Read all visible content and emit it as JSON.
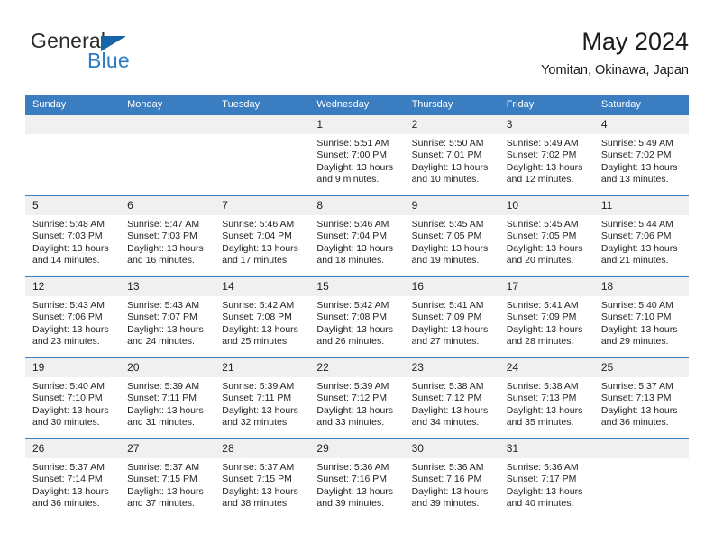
{
  "brand": {
    "name_top": "General",
    "name_bottom": "Blue",
    "triangle_color": "#1565a8",
    "blue_text_color": "#2e7dc4"
  },
  "header": {
    "title": "May 2024",
    "subtitle": "Yomitan, Okinawa, Japan"
  },
  "theme": {
    "header_blue": "#3a7dc0",
    "daynum_band": "#f0f0f0",
    "text": "#231f20"
  },
  "weekdays": [
    "Sunday",
    "Monday",
    "Tuesday",
    "Wednesday",
    "Thursday",
    "Friday",
    "Saturday"
  ],
  "weeks": [
    [
      {
        "day": "",
        "blank": true
      },
      {
        "day": "",
        "blank": true
      },
      {
        "day": "",
        "blank": true
      },
      {
        "day": "1",
        "sunrise": "Sunrise: 5:51 AM",
        "sunset": "Sunset: 7:00 PM",
        "daylight1": "Daylight: 13 hours",
        "daylight2": "and 9 minutes."
      },
      {
        "day": "2",
        "sunrise": "Sunrise: 5:50 AM",
        "sunset": "Sunset: 7:01 PM",
        "daylight1": "Daylight: 13 hours",
        "daylight2": "and 10 minutes."
      },
      {
        "day": "3",
        "sunrise": "Sunrise: 5:49 AM",
        "sunset": "Sunset: 7:02 PM",
        "daylight1": "Daylight: 13 hours",
        "daylight2": "and 12 minutes."
      },
      {
        "day": "4",
        "sunrise": "Sunrise: 5:49 AM",
        "sunset": "Sunset: 7:02 PM",
        "daylight1": "Daylight: 13 hours",
        "daylight2": "and 13 minutes."
      }
    ],
    [
      {
        "day": "5",
        "sunrise": "Sunrise: 5:48 AM",
        "sunset": "Sunset: 7:03 PM",
        "daylight1": "Daylight: 13 hours",
        "daylight2": "and 14 minutes."
      },
      {
        "day": "6",
        "sunrise": "Sunrise: 5:47 AM",
        "sunset": "Sunset: 7:03 PM",
        "daylight1": "Daylight: 13 hours",
        "daylight2": "and 16 minutes."
      },
      {
        "day": "7",
        "sunrise": "Sunrise: 5:46 AM",
        "sunset": "Sunset: 7:04 PM",
        "daylight1": "Daylight: 13 hours",
        "daylight2": "and 17 minutes."
      },
      {
        "day": "8",
        "sunrise": "Sunrise: 5:46 AM",
        "sunset": "Sunset: 7:04 PM",
        "daylight1": "Daylight: 13 hours",
        "daylight2": "and 18 minutes."
      },
      {
        "day": "9",
        "sunrise": "Sunrise: 5:45 AM",
        "sunset": "Sunset: 7:05 PM",
        "daylight1": "Daylight: 13 hours",
        "daylight2": "and 19 minutes."
      },
      {
        "day": "10",
        "sunrise": "Sunrise: 5:45 AM",
        "sunset": "Sunset: 7:05 PM",
        "daylight1": "Daylight: 13 hours",
        "daylight2": "and 20 minutes."
      },
      {
        "day": "11",
        "sunrise": "Sunrise: 5:44 AM",
        "sunset": "Sunset: 7:06 PM",
        "daylight1": "Daylight: 13 hours",
        "daylight2": "and 21 minutes."
      }
    ],
    [
      {
        "day": "12",
        "sunrise": "Sunrise: 5:43 AM",
        "sunset": "Sunset: 7:06 PM",
        "daylight1": "Daylight: 13 hours",
        "daylight2": "and 23 minutes."
      },
      {
        "day": "13",
        "sunrise": "Sunrise: 5:43 AM",
        "sunset": "Sunset: 7:07 PM",
        "daylight1": "Daylight: 13 hours",
        "daylight2": "and 24 minutes."
      },
      {
        "day": "14",
        "sunrise": "Sunrise: 5:42 AM",
        "sunset": "Sunset: 7:08 PM",
        "daylight1": "Daylight: 13 hours",
        "daylight2": "and 25 minutes."
      },
      {
        "day": "15",
        "sunrise": "Sunrise: 5:42 AM",
        "sunset": "Sunset: 7:08 PM",
        "daylight1": "Daylight: 13 hours",
        "daylight2": "and 26 minutes."
      },
      {
        "day": "16",
        "sunrise": "Sunrise: 5:41 AM",
        "sunset": "Sunset: 7:09 PM",
        "daylight1": "Daylight: 13 hours",
        "daylight2": "and 27 minutes."
      },
      {
        "day": "17",
        "sunrise": "Sunrise: 5:41 AM",
        "sunset": "Sunset: 7:09 PM",
        "daylight1": "Daylight: 13 hours",
        "daylight2": "and 28 minutes."
      },
      {
        "day": "18",
        "sunrise": "Sunrise: 5:40 AM",
        "sunset": "Sunset: 7:10 PM",
        "daylight1": "Daylight: 13 hours",
        "daylight2": "and 29 minutes."
      }
    ],
    [
      {
        "day": "19",
        "sunrise": "Sunrise: 5:40 AM",
        "sunset": "Sunset: 7:10 PM",
        "daylight1": "Daylight: 13 hours",
        "daylight2": "and 30 minutes."
      },
      {
        "day": "20",
        "sunrise": "Sunrise: 5:39 AM",
        "sunset": "Sunset: 7:11 PM",
        "daylight1": "Daylight: 13 hours",
        "daylight2": "and 31 minutes."
      },
      {
        "day": "21",
        "sunrise": "Sunrise: 5:39 AM",
        "sunset": "Sunset: 7:11 PM",
        "daylight1": "Daylight: 13 hours",
        "daylight2": "and 32 minutes."
      },
      {
        "day": "22",
        "sunrise": "Sunrise: 5:39 AM",
        "sunset": "Sunset: 7:12 PM",
        "daylight1": "Daylight: 13 hours",
        "daylight2": "and 33 minutes."
      },
      {
        "day": "23",
        "sunrise": "Sunrise: 5:38 AM",
        "sunset": "Sunset: 7:12 PM",
        "daylight1": "Daylight: 13 hours",
        "daylight2": "and 34 minutes."
      },
      {
        "day": "24",
        "sunrise": "Sunrise: 5:38 AM",
        "sunset": "Sunset: 7:13 PM",
        "daylight1": "Daylight: 13 hours",
        "daylight2": "and 35 minutes."
      },
      {
        "day": "25",
        "sunrise": "Sunrise: 5:37 AM",
        "sunset": "Sunset: 7:13 PM",
        "daylight1": "Daylight: 13 hours",
        "daylight2": "and 36 minutes."
      }
    ],
    [
      {
        "day": "26",
        "sunrise": "Sunrise: 5:37 AM",
        "sunset": "Sunset: 7:14 PM",
        "daylight1": "Daylight: 13 hours",
        "daylight2": "and 36 minutes."
      },
      {
        "day": "27",
        "sunrise": "Sunrise: 5:37 AM",
        "sunset": "Sunset: 7:15 PM",
        "daylight1": "Daylight: 13 hours",
        "daylight2": "and 37 minutes."
      },
      {
        "day": "28",
        "sunrise": "Sunrise: 5:37 AM",
        "sunset": "Sunset: 7:15 PM",
        "daylight1": "Daylight: 13 hours",
        "daylight2": "and 38 minutes."
      },
      {
        "day": "29",
        "sunrise": "Sunrise: 5:36 AM",
        "sunset": "Sunset: 7:16 PM",
        "daylight1": "Daylight: 13 hours",
        "daylight2": "and 39 minutes."
      },
      {
        "day": "30",
        "sunrise": "Sunrise: 5:36 AM",
        "sunset": "Sunset: 7:16 PM",
        "daylight1": "Daylight: 13 hours",
        "daylight2": "and 39 minutes."
      },
      {
        "day": "31",
        "sunrise": "Sunrise: 5:36 AM",
        "sunset": "Sunset: 7:17 PM",
        "daylight1": "Daylight: 13 hours",
        "daylight2": "and 40 minutes."
      },
      {
        "day": "",
        "blank": true
      }
    ]
  ]
}
